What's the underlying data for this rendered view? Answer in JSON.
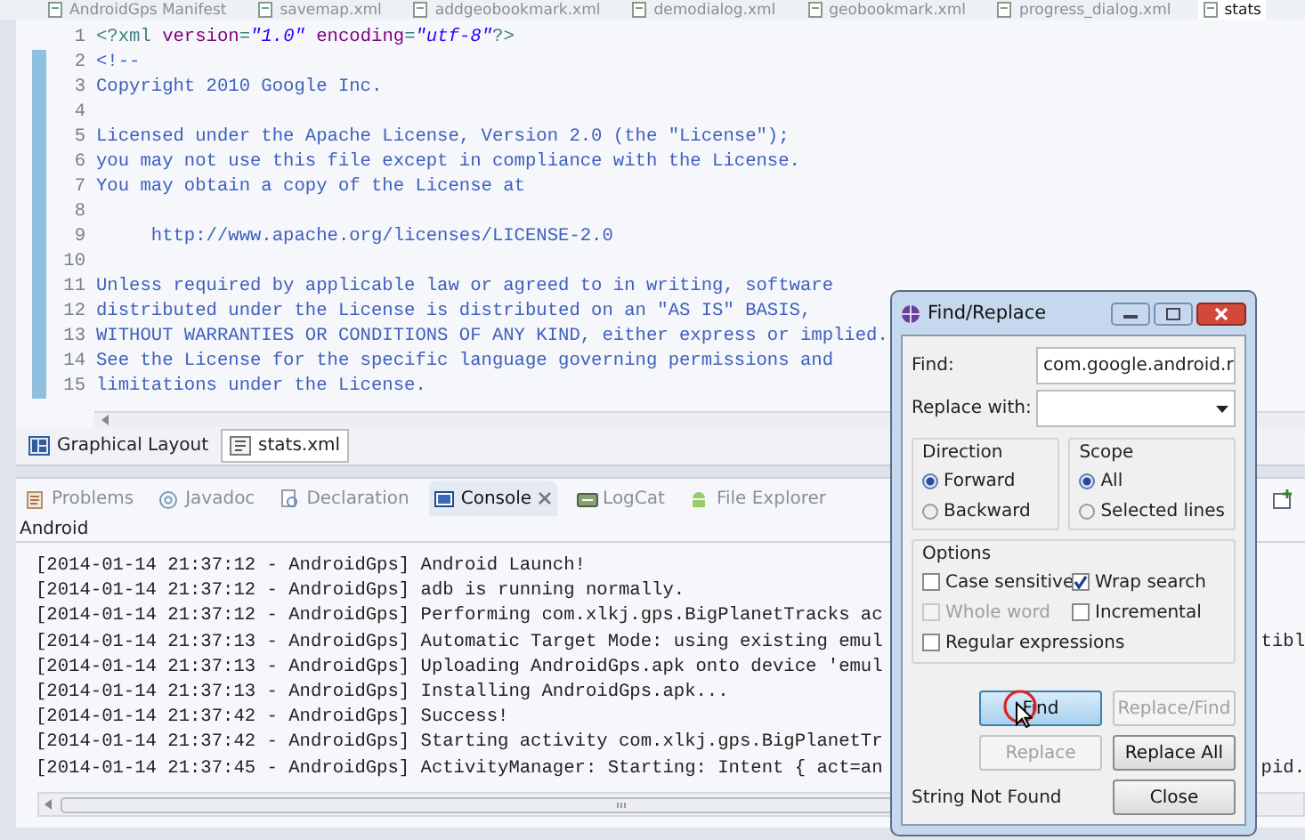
{
  "editor_tabs": [
    {
      "label": "AndroidGps Manifest",
      "selected": false
    },
    {
      "label": "savemap.xml",
      "selected": false
    },
    {
      "label": "addgeobookmark.xml",
      "selected": false
    },
    {
      "label": "demodialog.xml",
      "selected": false
    },
    {
      "label": "geobookmark.xml",
      "selected": false
    },
    {
      "label": "progress_dialog.xml",
      "selected": false
    },
    {
      "label": "stats",
      "selected": true
    }
  ],
  "editor": {
    "lines": [
      {
        "number": "1",
        "changed": false,
        "segments": [
          {
            "kind": "tag",
            "text": "<?xml "
          },
          {
            "kind": "attr",
            "text": "version"
          },
          {
            "kind": "tag",
            "text": "="
          },
          {
            "kind": "value",
            "text": "\"1.0\""
          },
          {
            "kind": "attr",
            "text": " encoding"
          },
          {
            "kind": "tag",
            "text": "="
          },
          {
            "kind": "value",
            "text": "\"utf-8\""
          },
          {
            "kind": "tag",
            "text": "?>"
          }
        ]
      },
      {
        "number": "2",
        "changed": true,
        "segments": [
          {
            "kind": "comment",
            "text": "<!--"
          }
        ]
      },
      {
        "number": "3",
        "changed": true,
        "segments": [
          {
            "kind": "comment",
            "text": "Copyright 2010 Google Inc."
          }
        ]
      },
      {
        "number": "4",
        "changed": true
      },
      {
        "number": "5",
        "changed": true,
        "segments": [
          {
            "kind": "comment",
            "text": "Licensed under the Apache License, Version 2.0 (the \"License\");"
          }
        ]
      },
      {
        "number": "6",
        "changed": true,
        "segments": [
          {
            "kind": "comment",
            "text": "you may not use this file except in compliance with the License."
          }
        ]
      },
      {
        "number": "7",
        "changed": true,
        "segments": [
          {
            "kind": "comment",
            "text": "You may obtain a copy of the License at"
          }
        ]
      },
      {
        "number": "8",
        "changed": true
      },
      {
        "number": "9",
        "changed": true,
        "segments": [
          {
            "kind": "comment",
            "text": "     http://www.apache.org/licenses/LICENSE-2.0"
          }
        ]
      },
      {
        "number": "10",
        "changed": true
      },
      {
        "number": "11",
        "changed": true,
        "segments": [
          {
            "kind": "comment",
            "text": "Unless required by applicable law or agreed to in writing, software"
          }
        ]
      },
      {
        "number": "12",
        "changed": true,
        "segments": [
          {
            "kind": "comment",
            "text": "distributed under the License is distributed on an \"AS IS\" BASIS,"
          }
        ]
      },
      {
        "number": "13",
        "changed": true,
        "segments": [
          {
            "kind": "comment",
            "text": "WITHOUT WARRANTIES OR CONDITIONS OF ANY KIND, either express or implied."
          }
        ]
      },
      {
        "number": "14",
        "changed": true,
        "segments": [
          {
            "kind": "comment",
            "text": "See the License for the specific language governing permissions and"
          }
        ]
      },
      {
        "number": "15",
        "changed": true,
        "segments": [
          {
            "kind": "comment",
            "text": "limitations under the License."
          }
        ]
      }
    ]
  },
  "editor_bottom_tabs": [
    {
      "label": "Graphical Layout",
      "selected": false
    },
    {
      "label": "stats.xml",
      "selected": true
    }
  ],
  "console_view": {
    "tabs": [
      {
        "label": "Problems",
        "selected": false
      },
      {
        "label": "Javadoc",
        "selected": false
      },
      {
        "label": "Declaration",
        "selected": false
      },
      {
        "label": "Console",
        "selected": true
      },
      {
        "label": "LogCat",
        "selected": false
      },
      {
        "label": "File Explorer",
        "selected": false
      }
    ],
    "title": "Android",
    "lines": [
      {
        "text": "[2014-01-14 21:37:12 - AndroidGps] Android Launch!"
      },
      {
        "text": "[2014-01-14 21:37:12 - AndroidGps] adb is running normally."
      },
      {
        "text": "[2014-01-14 21:37:12 - AndroidGps] Performing com.xlkj.gps.BigPlanetTracks ac"
      },
      {
        "text": "[2014-01-14 21:37:13 - AndroidGps] Automatic Target Mode: using existing emul",
        "tail": "tibl"
      },
      {
        "text": "[2014-01-14 21:37:13 - AndroidGps] Uploading AndroidGps.apk onto device 'emul"
      },
      {
        "text": "[2014-01-14 21:37:13 - AndroidGps] Installing AndroidGps.apk..."
      },
      {
        "text": "[2014-01-14 21:37:42 - AndroidGps] Success!"
      },
      {
        "text": "[2014-01-14 21:37:42 - AndroidGps] Starting activity com.xlkj.gps.BigPlanetTr"
      },
      {
        "text": "[2014-01-14 21:37:45 - AndroidGps] ActivityManager: Starting: Intent { act=an",
        "tail": "pid."
      }
    ]
  },
  "dialog": {
    "title": "Find/Replace",
    "find": {
      "label": "Find:",
      "value": "com.google.android.r"
    },
    "replace": {
      "label": "Replace with:"
    },
    "direction": {
      "title": "Direction",
      "options": [
        {
          "label": "Forward",
          "selected": true
        },
        {
          "label": "Backward",
          "selected": false
        }
      ]
    },
    "scope": {
      "title": "Scope",
      "options": [
        {
          "label": "All",
          "selected": true
        },
        {
          "label": "Selected lines",
          "selected": false
        }
      ]
    },
    "options": {
      "title": "Options",
      "items": [
        {
          "label": "Case sensitive",
          "checked": false,
          "disabled": false
        },
        {
          "label": "Wrap search",
          "checked": true,
          "disabled": false
        },
        {
          "label": "Whole word",
          "checked": false,
          "disabled": true
        },
        {
          "label": "Incremental",
          "checked": false,
          "disabled": false
        },
        {
          "label": "Regular expressions",
          "checked": false,
          "disabled": false
        }
      ]
    },
    "buttons": [
      {
        "label": "Find",
        "disabled": false,
        "default": true
      },
      {
        "label": "Replace/Find",
        "disabled": true,
        "default": false
      },
      {
        "label": "Replace",
        "disabled": true,
        "default": false
      },
      {
        "label": "Replace All",
        "disabled": false,
        "default": false
      }
    ],
    "status": "String Not Found",
    "close_button": {
      "label": "Close"
    }
  }
}
